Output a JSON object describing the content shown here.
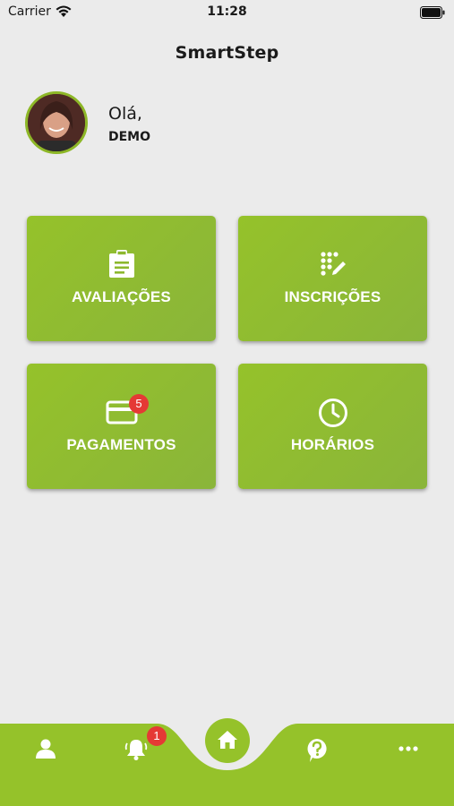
{
  "status_bar": {
    "carrier": "Carrier",
    "time": "11:28"
  },
  "header": {
    "title": "SmartStep"
  },
  "profile": {
    "greeting": "Olá,",
    "name": "DEMO"
  },
  "tiles": [
    {
      "label": "AVALIAÇÕES",
      "icon": "clipboard-icon"
    },
    {
      "label": "INSCRIÇÕES",
      "icon": "dots-pencil-icon"
    },
    {
      "label": "PAGAMENTOS",
      "icon": "credit-card-icon",
      "badge": "5"
    },
    {
      "label": "HORÁRIOS",
      "icon": "clock-icon"
    }
  ],
  "bottom_nav": {
    "items": [
      {
        "icon": "profile-icon"
      },
      {
        "icon": "bell-icon",
        "badge": "1"
      },
      {
        "icon": "home-icon"
      },
      {
        "icon": "help-icon"
      },
      {
        "icon": "more-icon"
      }
    ]
  },
  "colors": {
    "accent": "#95c22a",
    "background": "#ebebeb",
    "badge": "#e53935"
  }
}
